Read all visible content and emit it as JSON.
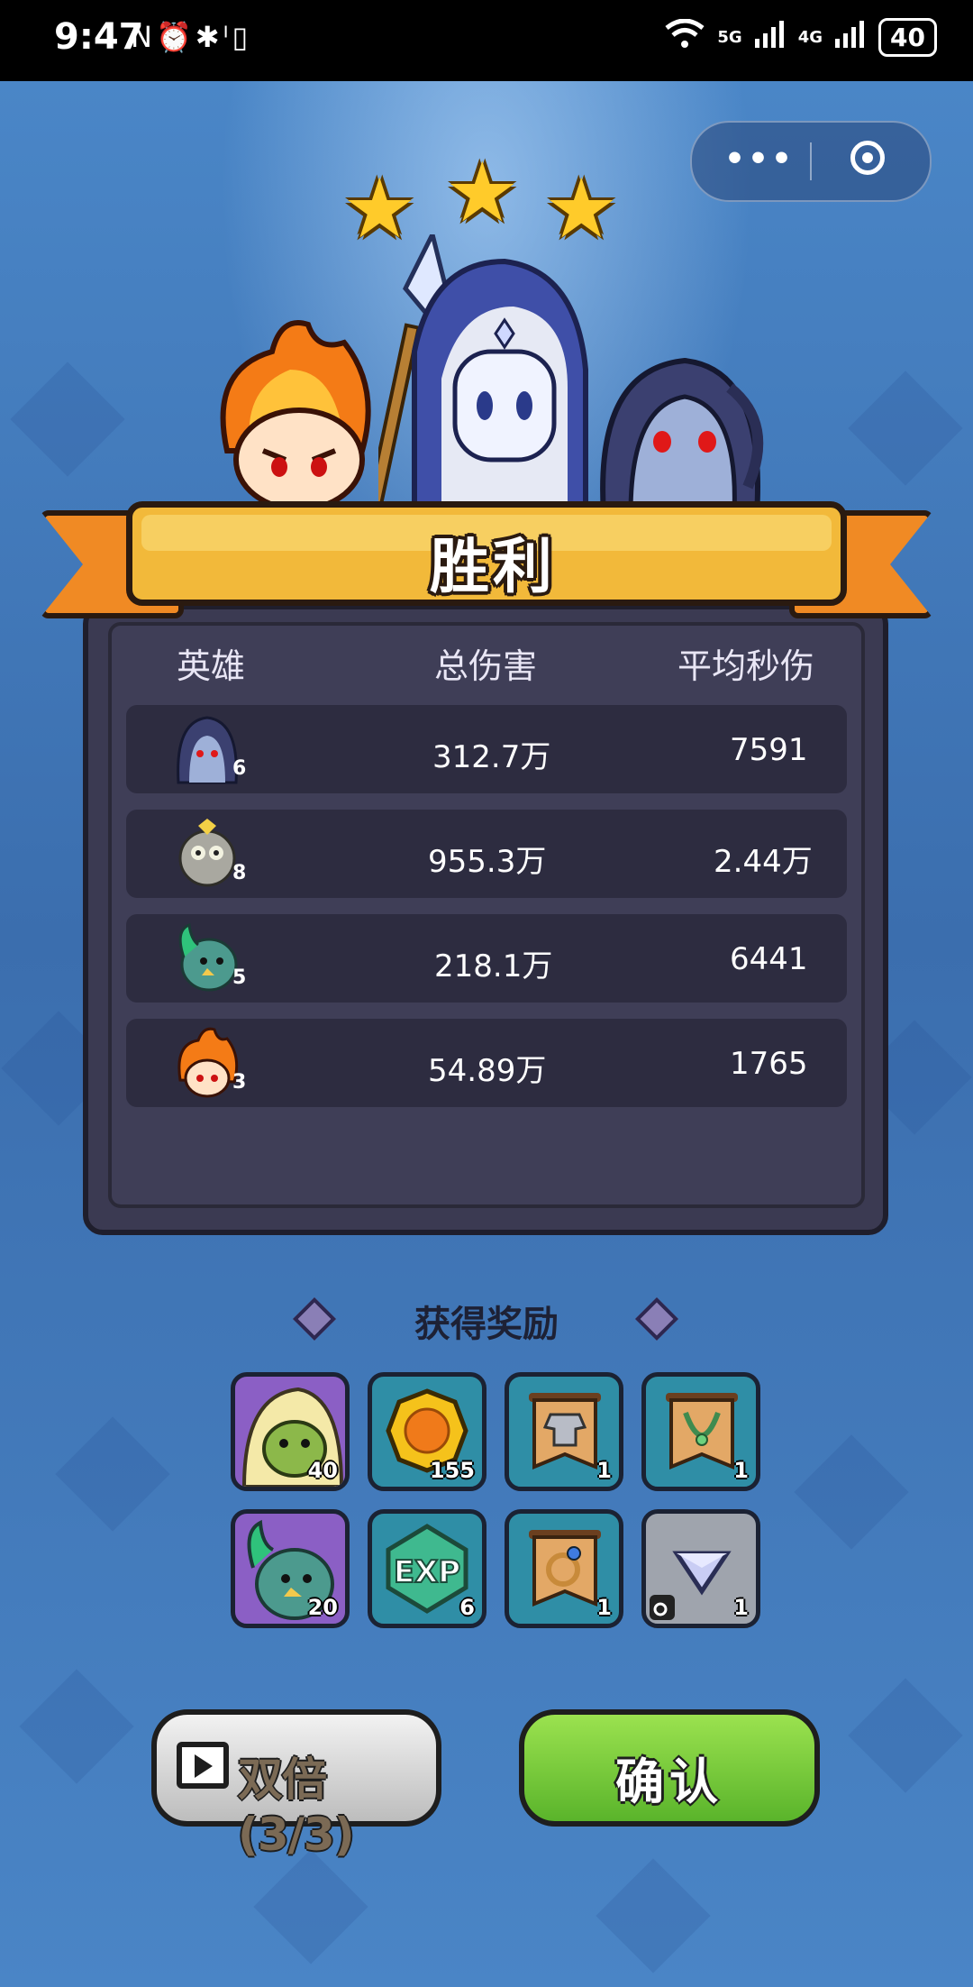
{
  "status_bar": {
    "time": "9:47",
    "left_icons": "N⏰✱ᴵ▯",
    "network": "5G",
    "network2": "4G",
    "battery": "40"
  },
  "mini_program": {
    "menu_label": "•••"
  },
  "stars": 3,
  "banner": {
    "title": "胜利"
  },
  "stats": {
    "headers": [
      "英雄",
      "总伤害",
      "平均秒伤"
    ],
    "rows": [
      {
        "hero_icon": "dark-elf-hero-icon",
        "level": "6",
        "total_damage": "312.7万",
        "avg_dps": "7591"
      },
      {
        "hero_icon": "owl-knight-hero-icon",
        "level": "8",
        "total_damage": "955.3万",
        "avg_dps": "2.44万"
      },
      {
        "hero_icon": "dragon-hero-icon",
        "level": "5",
        "total_damage": "218.1万",
        "avg_dps": "6441"
      },
      {
        "hero_icon": "fire-hero-icon",
        "level": "3",
        "total_damage": "54.89万",
        "avg_dps": "1765"
      }
    ]
  },
  "rewards": {
    "title": "获得奖励",
    "items": [
      {
        "icon": "hooded-goblin-icon",
        "count": "40"
      },
      {
        "icon": "gold-coin-icon",
        "count": "155"
      },
      {
        "icon": "armor-scroll-icon",
        "count": "1"
      },
      {
        "icon": "necklace-scroll-icon",
        "count": "1"
      },
      {
        "icon": "dragon-shard-icon",
        "count": "20"
      },
      {
        "icon": "exp-icon",
        "count": "6",
        "label": "EXP"
      },
      {
        "icon": "ring-scroll-icon",
        "count": "1"
      },
      {
        "icon": "gem-icon",
        "count": "1"
      }
    ]
  },
  "buttons": {
    "double_label": "双倍(3/3)",
    "confirm_label": "确认"
  }
}
